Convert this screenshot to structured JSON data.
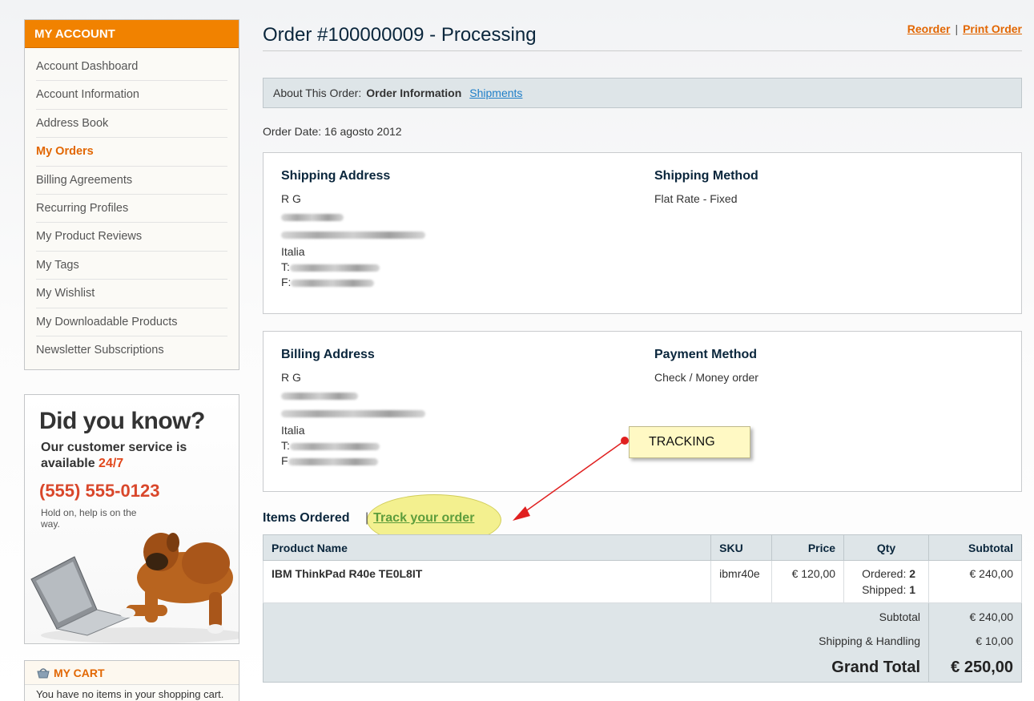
{
  "sidebar": {
    "header": "MY ACCOUNT",
    "items": [
      {
        "label": "Account Dashboard"
      },
      {
        "label": "Account Information"
      },
      {
        "label": "Address Book"
      },
      {
        "label": "My Orders"
      },
      {
        "label": "Billing Agreements"
      },
      {
        "label": "Recurring Profiles"
      },
      {
        "label": "My Product Reviews"
      },
      {
        "label": "My Tags"
      },
      {
        "label": "My Wishlist"
      },
      {
        "label": "My Downloadable Products"
      },
      {
        "label": "Newsletter Subscriptions"
      }
    ],
    "active_item": "My Orders",
    "promo": {
      "title": "Did you know?",
      "line1": "Our customer service is",
      "line2_prefix": "available ",
      "line2_highlight": "24/7",
      "phone": "(555) 555-0123",
      "hold_text": "Hold on, help is on the way."
    },
    "cart": {
      "header": "MY CART",
      "body": "You have no items in your shopping cart."
    }
  },
  "main": {
    "title": "Order #100000009 - Processing",
    "reorder": "Reorder",
    "separator": "|",
    "print_order": "Print Order",
    "tabs": {
      "about": "About This Order:",
      "current": "Order Information",
      "shipments": "Shipments"
    },
    "order_date": "Order Date: 16 agosto 2012",
    "shipping": {
      "address_title": "Shipping Address",
      "name": "R G",
      "country": "Italia",
      "phone_label": "T:",
      "fax_label": "F:",
      "method_title": "Shipping Method",
      "method": "Flat Rate - Fixed"
    },
    "billing": {
      "address_title": "Billing Address",
      "name": "R G",
      "country": "Italia",
      "phone_label": "T:",
      "fax_label": "F",
      "method_title": "Payment Method",
      "method": "Check / Money order"
    },
    "items_title": "Items Ordered",
    "track_separator": "|",
    "track_link": "Track your order",
    "annotation": "TRACKING",
    "table": {
      "headers": [
        "Product Name",
        "SKU",
        "Price",
        "Qty",
        "Subtotal"
      ],
      "rows": [
        {
          "name": "IBM ThinkPad R40e TE0L8IT",
          "sku": "ibmr40e",
          "price": "€ 120,00",
          "ordered_label": "Ordered:",
          "ordered": "2",
          "shipped_label": "Shipped:",
          "shipped": "1",
          "subtotal": "€ 240,00"
        }
      ],
      "totals": {
        "subtotal_label": "Subtotal",
        "subtotal": "€ 240,00",
        "shipping_label": "Shipping & Handling",
        "shipping": "€ 10,00",
        "grand_label": "Grand Total",
        "grand": "€ 250,00"
      }
    }
  },
  "colors": {
    "accent_orange": "#f18200",
    "link_blue": "#1e7ec8",
    "title_navy": "#0a263c",
    "table_header_bg": "#dee5e8",
    "track_link_green": "#5d9d3c",
    "highlight_yellow": "#f3f08a",
    "annotation_red": "#e02020"
  }
}
